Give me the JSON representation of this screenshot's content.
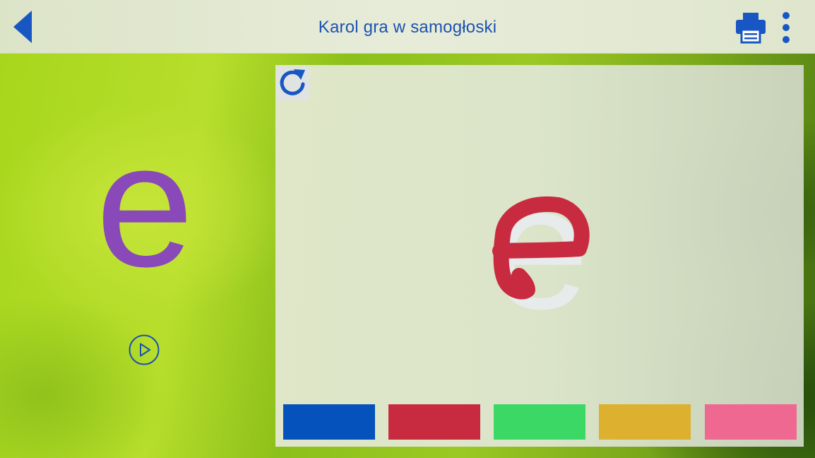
{
  "header": {
    "title": "Karol gra w samogłoski",
    "back_icon": "back-arrow-icon",
    "print_icon": "printer-icon",
    "menu_icon": "more-vertical-icon"
  },
  "letter": {
    "glyph": "e",
    "color": "#8a49b8",
    "play_icon": "play-icon"
  },
  "drawing": {
    "traced_glyph": "e",
    "stroke_color": "#c82b40",
    "refresh_icon": "refresh-icon"
  },
  "palette": [
    {
      "name": "blue",
      "color": "#0552bd"
    },
    {
      "name": "red",
      "color": "#c82b40"
    },
    {
      "name": "green",
      "color": "#3cd866"
    },
    {
      "name": "yellow",
      "color": "#ddb02f"
    },
    {
      "name": "pink",
      "color": "#ee6891"
    }
  ],
  "theme": {
    "accent": "#1c52b0"
  }
}
